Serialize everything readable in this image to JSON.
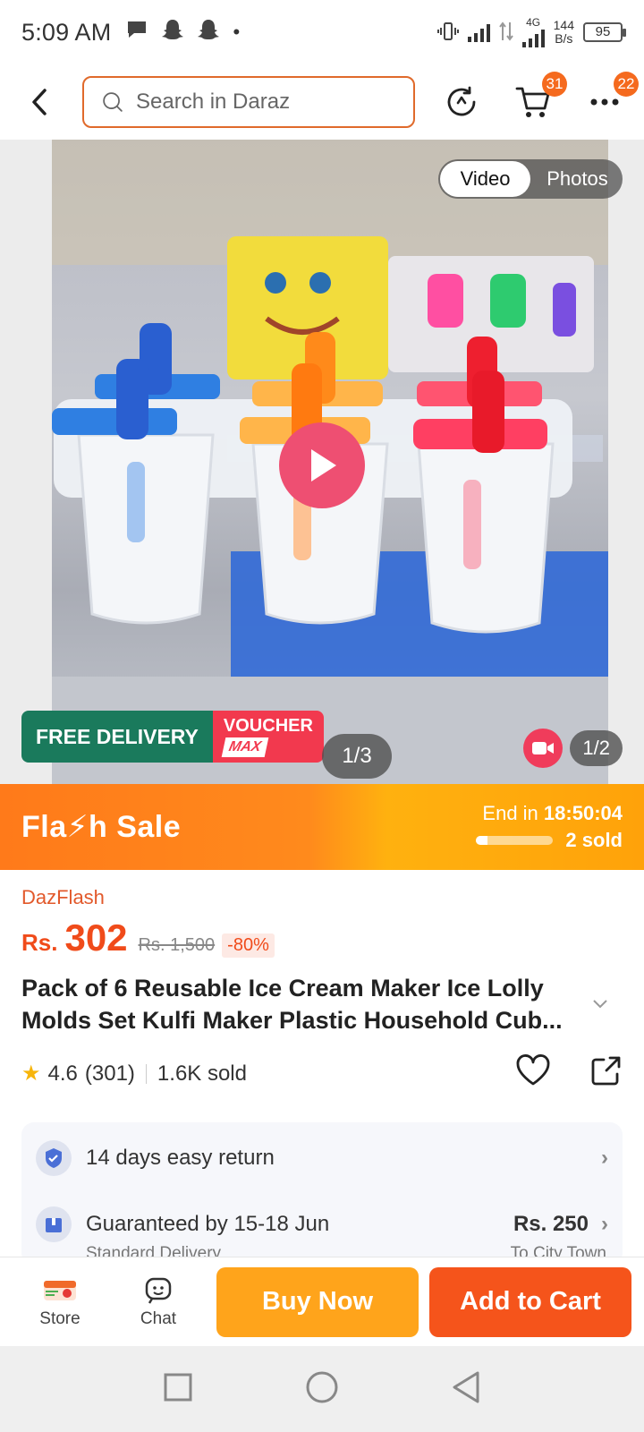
{
  "status_bar": {
    "time": "5:09 AM",
    "network_type": "4G",
    "speed_value": "144",
    "speed_unit": "B/s",
    "battery": "95"
  },
  "top_nav": {
    "search_placeholder": "Search in Daraz",
    "cart_badge": "31",
    "more_badge": "22"
  },
  "gallery": {
    "tab_video": "Video",
    "tab_photos": "Photos",
    "free_delivery": "FREE DELIVERY",
    "voucher": "VOUCHER",
    "voucher_max": "MAX",
    "image_counter": "1/3",
    "video_counter": "1/2"
  },
  "flash_sale": {
    "title": "Fla⚡h  Sale",
    "end_label": "End in",
    "end_time": "18:50:04",
    "sold": "2 sold",
    "sold_progress": 0.15
  },
  "product": {
    "campaign": "DazFlash",
    "currency": "Rs.",
    "price": "302",
    "original_price": "Rs. 1,500",
    "discount": "-80%",
    "title": "Pack of 6 Reusable Ice Cream Maker Ice Lolly Molds Set Kulfi Maker Plastic Household Cub...",
    "rating": "4.6",
    "reviews": "(301)",
    "sold": "1.6K sold"
  },
  "services": {
    "return_text": "14 days easy return",
    "delivery_text": "Guaranteed by 15-18 Jun",
    "delivery_fee": "Rs. 250",
    "delivery_type": "Standard Delivery",
    "delivery_location": "To City Town"
  },
  "bottom_bar": {
    "store_label": "Store",
    "chat_label": "Chat",
    "buy_now": "Buy Now",
    "add_to_cart": "Add to Cart"
  },
  "colors": {
    "brand_orange": "#f5541b",
    "buy_yellow": "#ffa41b",
    "free_delivery_green": "#1a7a5c",
    "voucher_red": "#f2394e"
  }
}
